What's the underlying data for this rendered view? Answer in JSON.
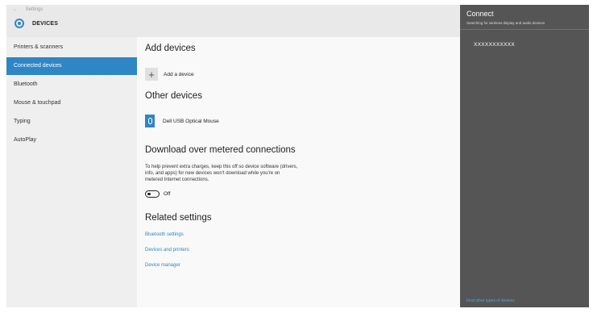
{
  "window": {
    "back_label": "Settings",
    "back_icon": "back-arrow-icon",
    "section_icon": "gear-icon",
    "section_title": "DEVICES"
  },
  "sidebar": {
    "items": [
      {
        "label": "Printers & scanners",
        "active": false
      },
      {
        "label": "Connected devices",
        "active": true
      },
      {
        "label": "Bluetooth",
        "active": false
      },
      {
        "label": "Mouse & touchpad",
        "active": false
      },
      {
        "label": "Typing",
        "active": false
      },
      {
        "label": "AutoPlay",
        "active": false
      }
    ]
  },
  "main": {
    "add_devices": {
      "heading": "Add devices",
      "button_label": "Add a device",
      "icon": "plus-icon"
    },
    "other_devices": {
      "heading": "Other devices",
      "devices": [
        {
          "name": "Dell USB Optical Mouse",
          "icon": "mouse-icon"
        }
      ]
    },
    "metered": {
      "heading": "Download over metered connections",
      "description": "To help prevent extra charges, keep this off so device software (drivers, info, and apps) for new devices won't download while you're on metered Internet connections.",
      "toggle_state": "Off"
    },
    "related": {
      "heading": "Related settings",
      "links": [
        "Bluetooth settings",
        "Devices and printers",
        "Device manager"
      ]
    }
  },
  "connect_pane": {
    "title": "Connect",
    "subtitle": "Searching for wireless display and audio devices",
    "device": "XXXXXXXXXXX",
    "footer_link": "Find other types of devices"
  },
  "colors": {
    "accent": "#2f86c4",
    "pane_bg": "#555555",
    "content_bg": "#f9f9f9",
    "sidebar_bg": "#efefef"
  }
}
